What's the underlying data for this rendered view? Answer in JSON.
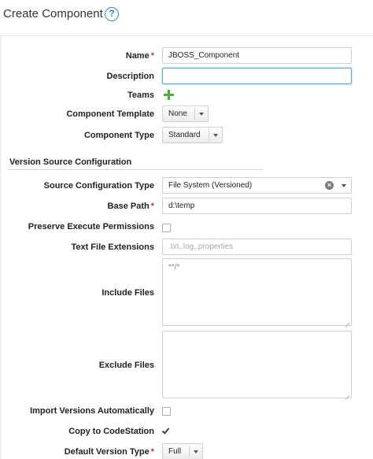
{
  "header": {
    "title": "Create Component",
    "help_icon": "question-circle-icon"
  },
  "fields": {
    "name": {
      "label": "Name",
      "required": "*",
      "value": "JBOSS_Component"
    },
    "description": {
      "label": "Description",
      "value": ""
    },
    "teams": {
      "label": "Teams",
      "add_icon": "plus-icon"
    },
    "component_template": {
      "label": "Component Template",
      "value": "None"
    },
    "component_type": {
      "label": "Component Type",
      "value": "Standard"
    }
  },
  "section": {
    "title": "Version Source Configuration"
  },
  "version_source": {
    "source_config_type": {
      "label": "Source Configuration Type",
      "value": "File System (Versioned)",
      "clear_icon": "clear-icon"
    },
    "base_path": {
      "label": "Base Path",
      "required": "*",
      "value": "d:\\temp"
    },
    "preserve_exec": {
      "label": "Preserve Execute Permissions",
      "checked": false
    },
    "text_file_ext": {
      "label": "Text File Extensions",
      "placeholder": ".txt,.log,.properties"
    },
    "include_files": {
      "label": "Include Files",
      "value": "**/*"
    },
    "exclude_files": {
      "label": "Exclude Files",
      "value": ""
    },
    "import_auto": {
      "label": "Import Versions Automatically",
      "checked": false
    },
    "copy_codestation": {
      "label": "Copy to CodeStation",
      "checked": true
    },
    "default_version_type": {
      "label": "Default Version Type",
      "required": "*",
      "value": "Full"
    }
  },
  "colors": {
    "accent": "#2e8bd6",
    "required": "#c0392b",
    "add": "#4caf36"
  }
}
